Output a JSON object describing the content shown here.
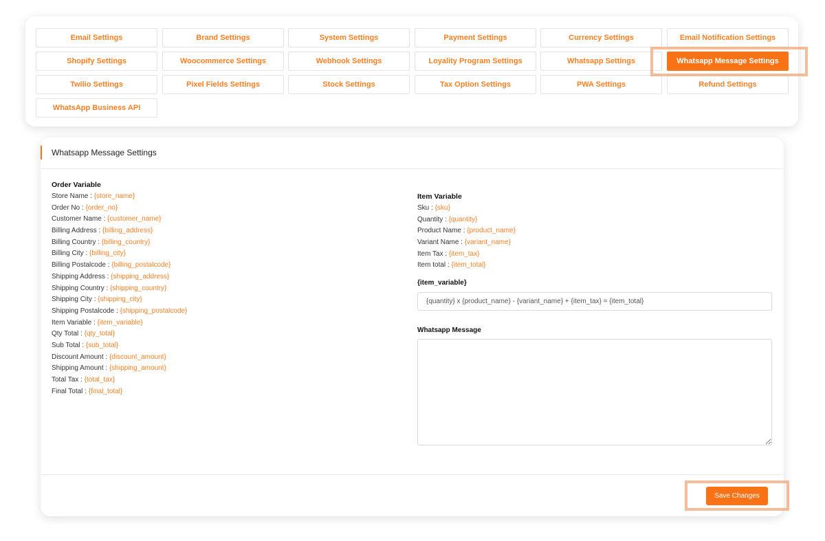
{
  "nav": {
    "tabs": [
      {
        "label": "Email Settings"
      },
      {
        "label": "Brand Settings"
      },
      {
        "label": "System Settings"
      },
      {
        "label": "Payment Settings"
      },
      {
        "label": "Currency Settings"
      },
      {
        "label": "Email Notification Settings"
      },
      {
        "label": "Shopify Settings"
      },
      {
        "label": "Woocommerce Settings"
      },
      {
        "label": "Webhook Settings"
      },
      {
        "label": "Loyality Program Settings"
      },
      {
        "label": "Whatsapp Settings"
      },
      {
        "label": "Whatsapp Message Settings"
      },
      {
        "label": "Twilio Settings"
      },
      {
        "label": "Pixel Fields Settings"
      },
      {
        "label": "Stock Settings"
      },
      {
        "label": "Tax Option Settings"
      },
      {
        "label": "PWA Settings"
      },
      {
        "label": "Refund Settings"
      },
      {
        "label": "WhatsApp Business API"
      }
    ],
    "active_index": 11
  },
  "card": {
    "title": "Whatsapp Message Settings"
  },
  "order_variable": {
    "heading": "Order Variable",
    "items": [
      {
        "label": "Store Name : ",
        "value": "{store_name}"
      },
      {
        "label": "Order No : ",
        "value": "{order_no}"
      },
      {
        "label": "Customer Name : ",
        "value": "{customer_name}"
      },
      {
        "label": "Billing Address : ",
        "value": "{billing_address}"
      },
      {
        "label": "Billing Country : ",
        "value": "{billing_country}"
      },
      {
        "label": "Billing City : ",
        "value": "{billing_city}"
      },
      {
        "label": "Billing Postalcode : ",
        "value": "{billing_postalcode}"
      },
      {
        "label": "Shipping Address : ",
        "value": "{shipping_address}"
      },
      {
        "label": "Shipping Country : ",
        "value": "{shipping_country}"
      },
      {
        "label": "Shipping City : ",
        "value": "{shipping_city}"
      },
      {
        "label": "Shipping Postalcode : ",
        "value": "{shipping_postalcode}"
      },
      {
        "label": "Item Variable : ",
        "value": "{item_variable}"
      },
      {
        "label": "Qty Total : ",
        "value": "{qty_total}"
      },
      {
        "label": "Sub Total : ",
        "value": "{sub_total}"
      },
      {
        "label": "Discount Amount : ",
        "value": "{discount_amount}"
      },
      {
        "label": "Shipping Amount : ",
        "value": "{shipping_amount}"
      },
      {
        "label": "Total Tax : ",
        "value": "{total_tax}"
      },
      {
        "label": "Final Total : ",
        "value": "{final_total}"
      }
    ]
  },
  "item_variable": {
    "heading": "Item Variable",
    "items": [
      {
        "label": "Sku : ",
        "value": "{sku}"
      },
      {
        "label": "Quantity : ",
        "value": "{quantity}"
      },
      {
        "label": "Product Name : ",
        "value": "{product_name}"
      },
      {
        "label": "Variant Name : ",
        "value": "{variant_name}"
      },
      {
        "label": "Item Tax : ",
        "value": "{item_tax}"
      },
      {
        "label": "Item total : ",
        "value": "{item_total}"
      }
    ]
  },
  "item_variable_field": {
    "label": "{item_variable}",
    "value": "{quantity} x {product_name} - {variant_name} + {item_tax} = {item_total}"
  },
  "message_field": {
    "label": "Whatsapp Message",
    "value": ""
  },
  "footer": {
    "save_label": "Save Changes"
  },
  "colors": {
    "accent": "#f97316",
    "link": "#f58025"
  }
}
